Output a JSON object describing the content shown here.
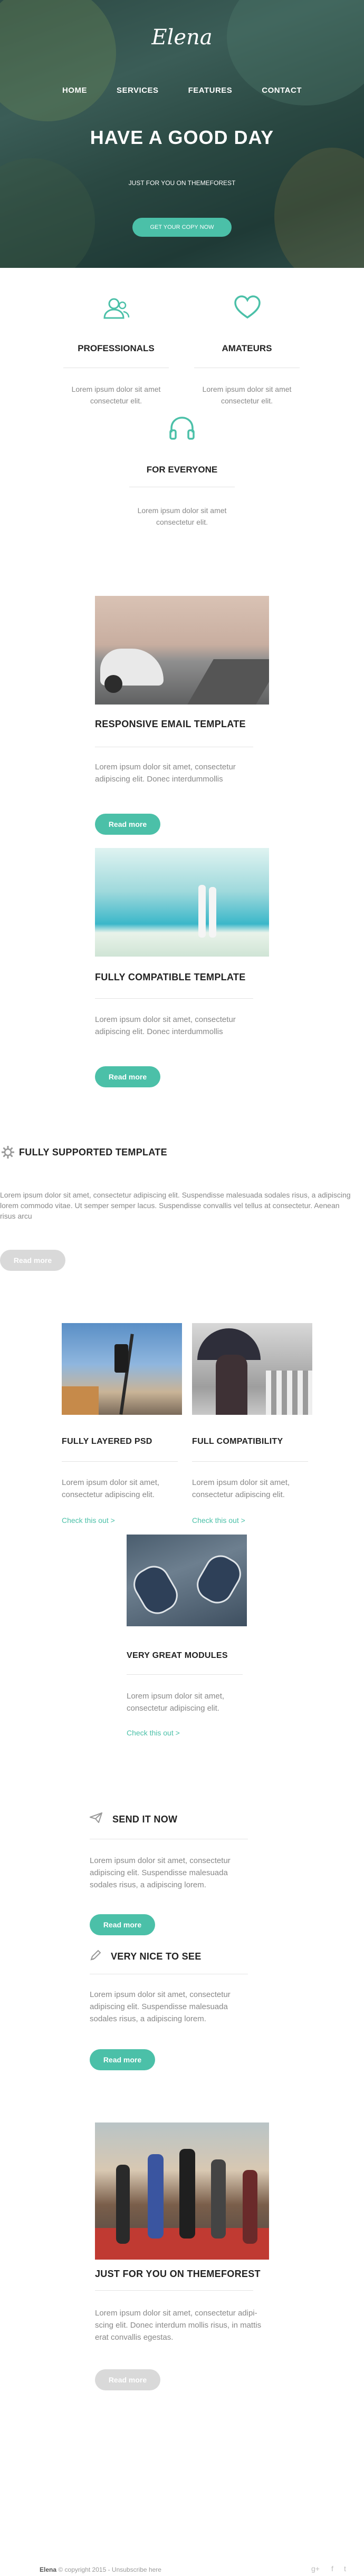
{
  "brand": {
    "logo": "Elena",
    "accent": "#4bc0a8"
  },
  "nav": [
    "HOME",
    "SERVICES",
    "FEATURES",
    "CONTACT"
  ],
  "hero": {
    "title": "HAVE A GOOD DAY",
    "subtitle": "JUST FOR YOU ON THEMEFOREST",
    "button": "GET YOUR COPY NOW"
  },
  "features": [
    {
      "icon": "users-icon",
      "title": "PROFESSIONALS",
      "text": "Lorem ipsum dolor sit amet consectetur elit."
    },
    {
      "icon": "heart-icon",
      "title": "AMATEURS",
      "text": "Lorem ipsum dolor sit amet consectetur elit."
    },
    {
      "icon": "headphones-icon",
      "title": "FOR EVERYONE",
      "text": "Lorem ipsum dolor sit amet consectetur elit."
    }
  ],
  "card_responsive": {
    "title": "RESPONSIVE EMAIL TEMPLATE",
    "text": "Lorem ipsum dolor sit amet, consectetur adipiscing elit. Donec interdummollis",
    "button": "Read more"
  },
  "card_compatible": {
    "title": "FULLY COMPATIBLE TEMPLATE",
    "text": "Lorem ipsum dolor sit amet, consectetur adipiscing elit. Donec interdummollis",
    "button": "Read more"
  },
  "card_supported": {
    "title": "FULLY SUPPORTED TEMPLATE",
    "text": "Lorem ipsum dolor sit amet, consectetur adipiscing elit. Suspendisse malesuada sodales risus, a adipiscing lorem commodo vitae. Ut semper semper lacus. Suspendisse convallis vel tellus at consectetur. Aenean risus arcu",
    "button": "Read more"
  },
  "grid": [
    {
      "title": "FULLY LAYERED PSD",
      "text": "Lorem ipsum dolor sit amet, consectetur adipiscing elit.",
      "link": "Check this out >"
    },
    {
      "title": "FULL COMPATIBILITY",
      "text": "Lorem ipsum dolor sit amet, consectetur adipiscing elit.",
      "link": "Check this out >"
    },
    {
      "title": "VERY GREAT MODULES",
      "text": "Lorem ipsum dolor sit amet, consectetur adipiscing elit.",
      "link": "Check this out >"
    }
  ],
  "send": {
    "title": "SEND IT NOW",
    "text": "Lorem ipsum dolor sit amet, consectetur adipiscing elit. Suspendisse malesuada sodales risus, a adipiscing lorem.",
    "button": "Read more"
  },
  "nice": {
    "title": "VERY NICE TO SEE",
    "text": "Lorem ipsum dolor sit amet, consectetur adipiscing elit. Suspendisse malesuada sodales risus, a adipiscing lorem.",
    "button": "Read more"
  },
  "themeforest": {
    "title": "JUST FOR YOU ON THEMEFOREST",
    "text": "Lorem ipsum dolor sit amet, consectetur adipi-scing elit. Donec interdum mollis risus, in mattis erat convallis egestas.",
    "button": "Read more"
  },
  "footer": {
    "brand": "Elena",
    "copy": " © copyright 2015 - Unsubscribe here",
    "social": [
      "google-plus-icon",
      "facebook-icon",
      "twitter-icon"
    ]
  }
}
